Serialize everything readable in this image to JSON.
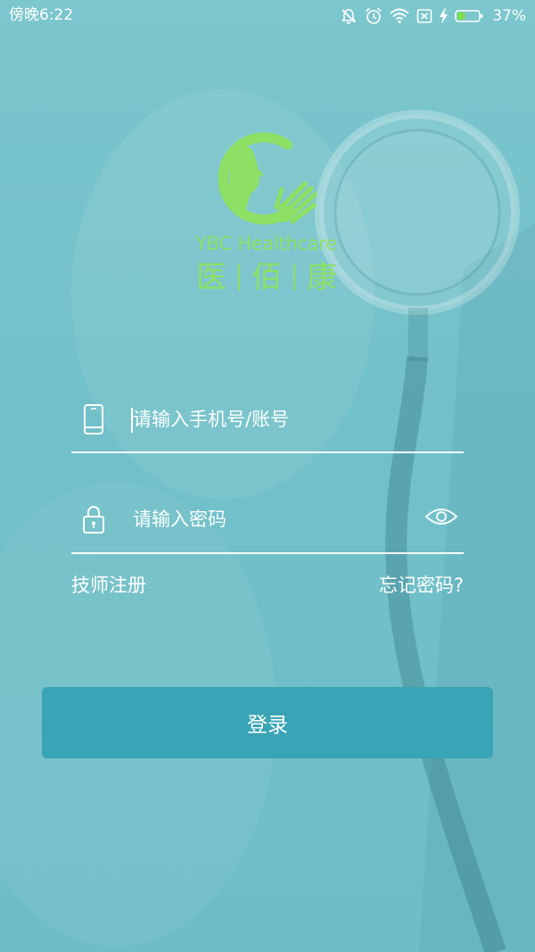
{
  "status_bar": {
    "time": "傍晚6:22",
    "battery_percent": "37%",
    "battery_level": 0.37,
    "charging": true,
    "icons": [
      "mute-icon",
      "alarm-icon",
      "wifi-icon",
      "no-sim-icon",
      "charging-icon",
      "battery-icon"
    ]
  },
  "logo": {
    "brand_en": "YBC Healthcare",
    "brand_cn": [
      "医",
      "佰",
      "康"
    ]
  },
  "login_form": {
    "account": {
      "icon": "phone-icon",
      "placeholder": "请输入手机号/账号",
      "value": ""
    },
    "password": {
      "icon": "lock-icon",
      "placeholder": "请输入密码",
      "value": "",
      "toggle_icon": "eye-icon"
    },
    "register_link": "技师注册",
    "forgot_password_link": "忘记密码?",
    "submit_label": "登录"
  },
  "colors": {
    "background": "#72c0c9",
    "brand_green": "#8ee064",
    "button": "#39a4b5",
    "text": "#ffffff",
    "battery_fill": "#7ddf4c"
  }
}
